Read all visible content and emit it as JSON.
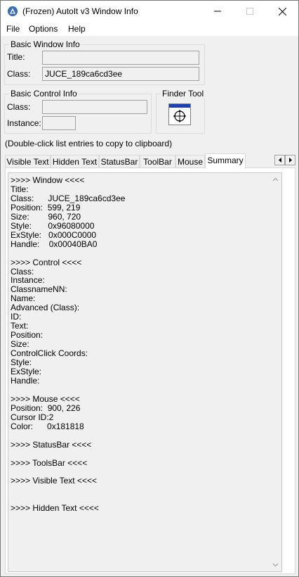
{
  "window": {
    "title": "(Frozen) AutoIt v3 Window Info"
  },
  "menu": {
    "file": "File",
    "options": "Options",
    "help": "Help"
  },
  "basic_window_info": {
    "legend": "Basic Window Info",
    "title_label": "Title:",
    "title_value": "",
    "class_label": "Class:",
    "class_value": "JUCE_189ca6cd3ee"
  },
  "basic_control_info": {
    "legend": "Basic Control Info",
    "class_label": "Class:",
    "class_value": "",
    "instance_label": "Instance:",
    "instance_value": ""
  },
  "finder_tool": {
    "legend": "Finder Tool"
  },
  "hint": "(Double-click list entries to copy to clipboard)",
  "tabs": [
    {
      "label": "Visible Text"
    },
    {
      "label": "Hidden Text"
    },
    {
      "label": "StatusBar"
    },
    {
      "label": "ToolBar"
    },
    {
      "label": "Mouse"
    },
    {
      "label": "Summary"
    }
  ],
  "summary": {
    "lines": [
      ">>>> Window <<<<",
      "Title:",
      "Class:      JUCE_189ca6cd3ee",
      "Position:  599, 219",
      "Size:        960, 720",
      "Style:       0x96080000",
      "ExStyle:   0x000C0000",
      "Handle:    0x00040BA0",
      "",
      ">>>> Control <<<<",
      "Class:",
      "Instance:",
      "ClassnameNN:",
      "Name:",
      "Advanced (Class):",
      "ID:",
      "Text:",
      "Position:",
      "Size:",
      "ControlClick Coords:",
      "Style:",
      "ExStyle:",
      "Handle:",
      "",
      ">>>> Mouse <<<<",
      "Position:  900, 226",
      "Cursor ID:2",
      "Color:      0x181818",
      "",
      ">>>> StatusBar <<<<",
      "",
      ">>>> ToolsBar <<<<",
      "",
      ">>>> Visible Text <<<<",
      "",
      "",
      ">>>> Hidden Text <<<<"
    ]
  }
}
